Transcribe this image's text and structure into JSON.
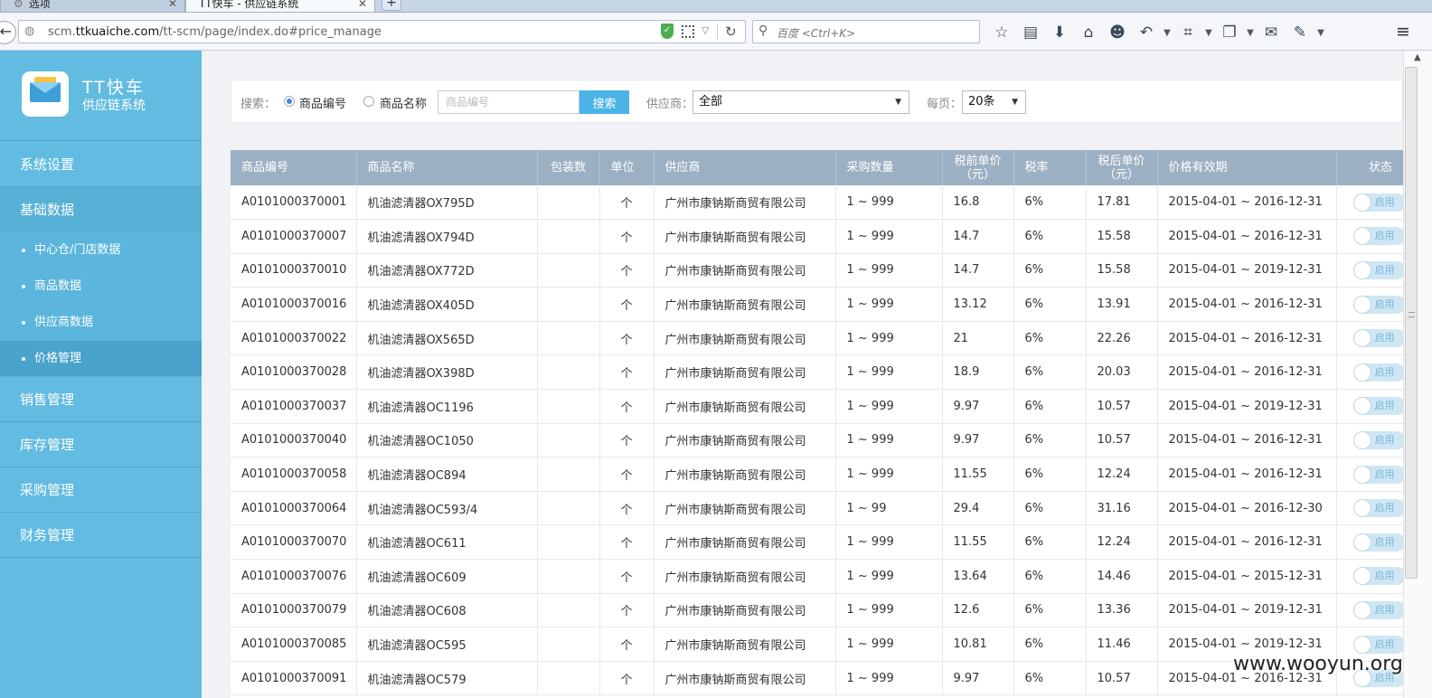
{
  "browser": {
    "tabs": [
      {
        "label": "选项"
      },
      {
        "label": "TT快车 - 供应链系统"
      }
    ],
    "new_tab": "+",
    "url_prefix": "scm.",
    "url_domain": "ttkuaiche.com",
    "url_path": "/tt-scm/page/index.do#price_manage",
    "search_placeholder": "百度 <Ctrl+K>"
  },
  "app": {
    "logo_title": "TT快车",
    "logo_subtitle": "供应链系统"
  },
  "sidebar": {
    "items": [
      {
        "label": "系统设置"
      },
      {
        "label": "基础数据"
      },
      {
        "label": "销售管理"
      },
      {
        "label": "库存管理"
      },
      {
        "label": "采购管理"
      },
      {
        "label": "财务管理"
      }
    ],
    "sub_items": [
      {
        "label": "中心仓/门店数据"
      },
      {
        "label": "商品数据"
      },
      {
        "label": "供应商数据"
      },
      {
        "label": "价格管理"
      }
    ]
  },
  "filter": {
    "search_label": "搜索：",
    "radio_code": "商品编号",
    "radio_name": "商品名称",
    "input_placeholder": "商品编号",
    "search_button": "搜索",
    "supplier_label": "供应商：",
    "supplier_value": "全部",
    "per_page_label": "每页：",
    "per_page_value": "20条"
  },
  "table": {
    "headers": [
      "商品编号",
      "商品名称",
      "包装数",
      "单位",
      "供应商",
      "采购数量",
      "税前单价（元）",
      "税率",
      "税后单价（元）",
      "价格有效期",
      "状态"
    ],
    "status_label": "启用",
    "rows": [
      [
        "A0101000370001",
        "机油滤清器OX795D",
        "",
        "个",
        "广州市康钠斯商贸有限公司",
        "1 ~ 999",
        "16.8",
        "6%",
        "17.81",
        "2015-04-01 ~ 2016-12-31"
      ],
      [
        "A0101000370007",
        "机油滤清器OX794D",
        "",
        "个",
        "广州市康钠斯商贸有限公司",
        "1 ~ 999",
        "14.7",
        "6%",
        "15.58",
        "2015-04-01 ~ 2016-12-31"
      ],
      [
        "A0101000370010",
        "机油滤清器OX772D",
        "",
        "个",
        "广州市康钠斯商贸有限公司",
        "1 ~ 999",
        "14.7",
        "6%",
        "15.58",
        "2015-04-01 ~ 2019-12-31"
      ],
      [
        "A0101000370016",
        "机油滤清器OX405D",
        "",
        "个",
        "广州市康钠斯商贸有限公司",
        "1 ~ 999",
        "13.12",
        "6%",
        "13.91",
        "2015-04-01 ~ 2016-12-31"
      ],
      [
        "A0101000370022",
        "机油滤清器OX565D",
        "",
        "个",
        "广州市康钠斯商贸有限公司",
        "1 ~ 999",
        "21",
        "6%",
        "22.26",
        "2015-04-01 ~ 2016-12-31"
      ],
      [
        "A0101000370028",
        "机油滤清器OX398D",
        "",
        "个",
        "广州市康钠斯商贸有限公司",
        "1 ~ 999",
        "18.9",
        "6%",
        "20.03",
        "2015-04-01 ~ 2016-12-31"
      ],
      [
        "A0101000370037",
        "机油滤清器OC1196",
        "",
        "个",
        "广州市康钠斯商贸有限公司",
        "1 ~ 999",
        "9.97",
        "6%",
        "10.57",
        "2015-04-01 ~ 2019-12-31"
      ],
      [
        "A0101000370040",
        "机油滤清器OC1050",
        "",
        "个",
        "广州市康钠斯商贸有限公司",
        "1 ~ 999",
        "9.97",
        "6%",
        "10.57",
        "2015-04-01 ~ 2016-12-31"
      ],
      [
        "A0101000370058",
        "机油滤清器OC894",
        "",
        "个",
        "广州市康钠斯商贸有限公司",
        "1 ~ 999",
        "11.55",
        "6%",
        "12.24",
        "2015-04-01 ~ 2016-12-31"
      ],
      [
        "A0101000370064",
        "机油滤清器OC593/4",
        "",
        "个",
        "广州市康钠斯商贸有限公司",
        "1 ~ 99",
        "29.4",
        "6%",
        "31.16",
        "2015-04-01 ~ 2016-12-30"
      ],
      [
        "A0101000370070",
        "机油滤清器OC611",
        "",
        "个",
        "广州市康钠斯商贸有限公司",
        "1 ~ 999",
        "11.55",
        "6%",
        "12.24",
        "2015-04-01 ~ 2016-12-31"
      ],
      [
        "A0101000370076",
        "机油滤清器OC609",
        "",
        "个",
        "广州市康钠斯商贸有限公司",
        "1 ~ 999",
        "13.64",
        "6%",
        "14.46",
        "2015-04-01 ~ 2015-12-31"
      ],
      [
        "A0101000370079",
        "机油滤清器OC608",
        "",
        "个",
        "广州市康钠斯商贸有限公司",
        "1 ~ 999",
        "12.6",
        "6%",
        "13.36",
        "2015-04-01 ~ 2019-12-31"
      ],
      [
        "A0101000370085",
        "机油滤清器OC595",
        "",
        "个",
        "广州市康钠斯商贸有限公司",
        "1 ~ 999",
        "10.81",
        "6%",
        "11.46",
        "2015-04-01 ~ 2019-12-31"
      ],
      [
        "A0101000370091",
        "机油滤清器OC579",
        "",
        "个",
        "广州市康钠斯商贸有限公司",
        "1 ~ 999",
        "9.97",
        "6%",
        "10.57",
        "2015-04-01 ~ 2016-12-31"
      ]
    ]
  },
  "watermark": "www.wooyun.org",
  "icons": [
    "gear-icon",
    "close-icon",
    "back-icon",
    "globe-icon",
    "shield-icon",
    "qr-code-icon",
    "reload-icon",
    "search-icon",
    "star-icon",
    "reading-list-icon",
    "download-icon",
    "home-icon",
    "emoji-icon",
    "undo-icon",
    "crop-icon",
    "page-icon",
    "chat-icon",
    "extension-icon",
    "menu-icon"
  ],
  "colors": {
    "sidebar": "#62bbe0",
    "table_header": "#9cb0c3",
    "search_button": "#4bb3e6",
    "active_sub_item": "#4aa3cc"
  }
}
